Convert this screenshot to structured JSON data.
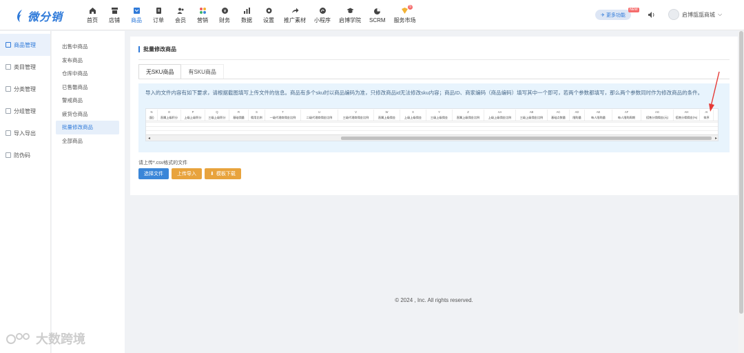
{
  "brand": {
    "name": "微分销",
    "color": "#2f7ad9"
  },
  "nav": [
    {
      "label": "首页",
      "icon": "home-icon"
    },
    {
      "label": "店铺",
      "icon": "shop-icon"
    },
    {
      "label": "商品",
      "icon": "goods-icon",
      "active": true
    },
    {
      "label": "订单",
      "icon": "order-icon"
    },
    {
      "label": "会员",
      "icon": "member-icon"
    },
    {
      "label": "营销",
      "icon": "marketing-icon"
    },
    {
      "label": "财务",
      "icon": "finance-icon"
    },
    {
      "label": "数据",
      "icon": "data-icon"
    },
    {
      "label": "设置",
      "icon": "settings-icon"
    },
    {
      "label": "推广素材",
      "icon": "share-icon"
    },
    {
      "label": "小程序",
      "icon": "miniprogram-icon"
    },
    {
      "label": "启博学院",
      "icon": "academy-icon"
    },
    {
      "label": "SCRM",
      "icon": "scrm-icon"
    },
    {
      "label": "服务市场",
      "icon": "market-icon",
      "badge": "5"
    }
  ],
  "header": {
    "more_label": "更多功能",
    "new_tag": "NEW",
    "user_name": "启博瓿瓿商城"
  },
  "sidebar": [
    {
      "label": "商品管理",
      "active": true
    },
    {
      "label": "类目管理"
    },
    {
      "label": "分类管理"
    },
    {
      "label": "分组管理"
    },
    {
      "label": "导入导出"
    },
    {
      "label": "防伪码"
    }
  ],
  "subsidebar": [
    {
      "label": "出售中商品"
    },
    {
      "label": "发布商品"
    },
    {
      "label": "仓库中商品"
    },
    {
      "label": "已售罄商品"
    },
    {
      "label": "警戒商品"
    },
    {
      "label": "疲货仓商品"
    },
    {
      "label": "批量修改商品",
      "active": true
    },
    {
      "label": "全部商品"
    }
  ],
  "main": {
    "title": "批量修改商品",
    "tabs": [
      {
        "label": "无SKU商品",
        "active": true
      },
      {
        "label": "有SKU商品"
      }
    ],
    "info": "导入的文件内容有如下要求，请根据截图填写上传文件的信息。商品有多个sku时以商品编码为准，只修改商品id无法修改sku内容；商品ID、商家编码（商品编码）填写其中一个即可，若两个参数都填写，那么两个参数同时作为修改商品的条件。",
    "sheet": {
      "letters": [
        "N",
        "O",
        "P",
        "Q",
        "R",
        "S",
        "T",
        "U",
        "V",
        "W",
        "X",
        "Y",
        "Z",
        "AA",
        "AB",
        "AC",
        "AD",
        "AE",
        "AF",
        "AG",
        "AH",
        "AI"
      ],
      "headers": [
        "(配)",
        "直属上级积分",
        "上级上级积分",
        "三级上级积分",
        "基础佣量",
        "佣用比例",
        "一级代理商佣金比例",
        "二级代理商佣金比例",
        "三级代理商佣金比例",
        "直属上级佣金",
        "上级上级佣金",
        "三级上级佣金",
        "直属上级佣金比例",
        "上级上级佣金比例",
        "三级上级佣金比例",
        "基础点数量",
        "限购量",
        "每人限购量",
        "每人限购周期",
        "搭售分佣佣金(元)",
        "搭售分佣佣金(%)",
        "排序"
      ]
    },
    "upload_hint": "请上传*.csv格式的文件",
    "buttons": {
      "choose": "选择文件",
      "upload": "上传导入",
      "download": "模板下载"
    }
  },
  "footer": "© 2024 , Inc. All rights reserved.",
  "watermark": "大数跨境"
}
